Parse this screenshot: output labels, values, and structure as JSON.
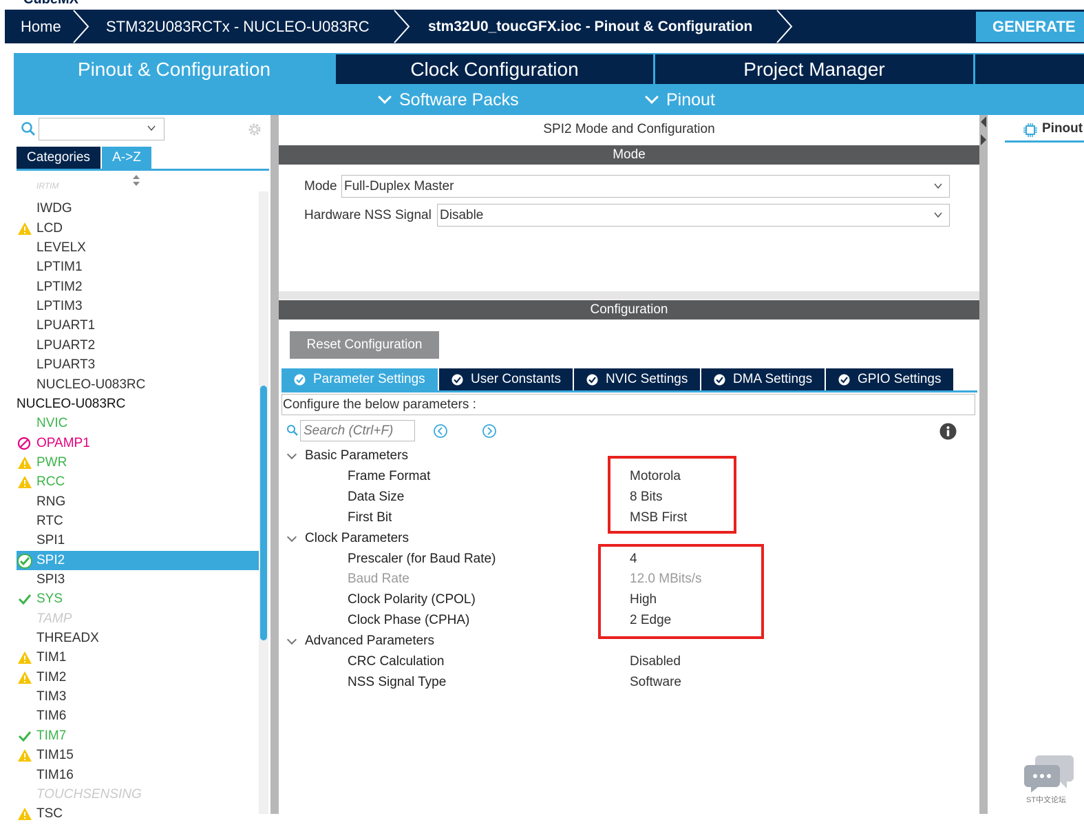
{
  "app": {
    "logo_text": "CubeMX"
  },
  "breadcrumb": {
    "home": "Home",
    "board": "STM32U083RCTx  -  NUCLEO-U083RC",
    "file": "stm32U0_toucGFX.ioc - Pinout & Configuration"
  },
  "generate_label": "GENERATE",
  "main_tabs": {
    "pinout": "Pinout & Configuration",
    "clock": "Clock Configuration",
    "project": "Project Manager"
  },
  "sub_tabs": {
    "software_packs": "Software Packs",
    "pinout": "Pinout"
  },
  "left": {
    "search_value": "",
    "tab_categories": "Categories",
    "tab_az": "A->Z",
    "items": [
      {
        "label": "IRTIM",
        "status": "grey"
      },
      {
        "label": "IWDG",
        "status": "normal"
      },
      {
        "label": "LCD",
        "status": "warning"
      },
      {
        "label": "LEVELX",
        "status": "normal"
      },
      {
        "label": "LPTIM1",
        "status": "normal"
      },
      {
        "label": "LPTIM2",
        "status": "normal"
      },
      {
        "label": "LPTIM3",
        "status": "normal"
      },
      {
        "label": "LPUART1",
        "status": "normal"
      },
      {
        "label": "LPUART2",
        "status": "normal"
      },
      {
        "label": "LPUART3",
        "status": "normal"
      },
      {
        "label": "NUCLEO-U083RC",
        "status": "normal"
      },
      {
        "label": "NUCLEO-U083RC",
        "status": "header"
      },
      {
        "label": "NVIC",
        "status": "green"
      },
      {
        "label": "OPAMP1",
        "status": "disabled"
      },
      {
        "label": "PWR",
        "status": "warning-green"
      },
      {
        "label": "RCC",
        "status": "warning-green"
      },
      {
        "label": "RNG",
        "status": "normal"
      },
      {
        "label": "RTC",
        "status": "normal"
      },
      {
        "label": "SPI1",
        "status": "normal"
      },
      {
        "label": "SPI2",
        "status": "selected"
      },
      {
        "label": "SPI3",
        "status": "normal"
      },
      {
        "label": "SYS",
        "status": "check-green"
      },
      {
        "label": "TAMP",
        "status": "grey"
      },
      {
        "label": "THREADX",
        "status": "normal"
      },
      {
        "label": "TIM1",
        "status": "warning"
      },
      {
        "label": "TIM2",
        "status": "warning"
      },
      {
        "label": "TIM3",
        "status": "normal"
      },
      {
        "label": "TIM6",
        "status": "normal"
      },
      {
        "label": "TIM7",
        "status": "check-green"
      },
      {
        "label": "TIM15",
        "status": "warning"
      },
      {
        "label": "TIM16",
        "status": "normal"
      },
      {
        "label": "TOUCHSENSING",
        "status": "grey"
      },
      {
        "label": "TSC",
        "status": "warning"
      }
    ]
  },
  "center": {
    "title": "SPI2 Mode and Configuration",
    "mode_header": "Mode",
    "mode_label": "Mode",
    "mode_value": "Full-Duplex Master",
    "nss_label": "Hardware NSS Signal",
    "nss_value": "Disable",
    "config_header": "Configuration",
    "reset_label": "Reset Configuration",
    "tabs": [
      "Parameter Settings",
      "User Constants",
      "NVIC Settings",
      "DMA Settings",
      "GPIO Settings"
    ],
    "description": "Configure the below parameters :",
    "search_placeholder": "Search (Ctrl+F)",
    "groups": [
      {
        "label": "Basic Parameters",
        "params": [
          {
            "name": "Frame Format",
            "value": "Motorola"
          },
          {
            "name": "Data Size",
            "value": "8 Bits"
          },
          {
            "name": "First Bit",
            "value": "MSB First"
          }
        ]
      },
      {
        "label": "Clock Parameters",
        "params": [
          {
            "name": "Prescaler (for Baud Rate)",
            "value": "4"
          },
          {
            "name": "Baud Rate",
            "value": "12.0 MBits/s"
          },
          {
            "name": "Clock Polarity (CPOL)",
            "value": "High"
          },
          {
            "name": "Clock Phase (CPHA)",
            "value": "2 Edge"
          }
        ]
      },
      {
        "label": "Advanced Parameters",
        "params": [
          {
            "name": "CRC Calculation",
            "value": "Disabled"
          },
          {
            "name": "NSS Signal Type",
            "value": "Software"
          }
        ]
      }
    ]
  },
  "right": {
    "view_label": "Pinout view"
  },
  "watermark": {
    "text": "ST中文论坛"
  },
  "colors": {
    "navy": "#03234b",
    "accent": "#39a9dc",
    "green": "#3cb44b",
    "warning": "#f5c400",
    "highlight": "#e8211e"
  }
}
